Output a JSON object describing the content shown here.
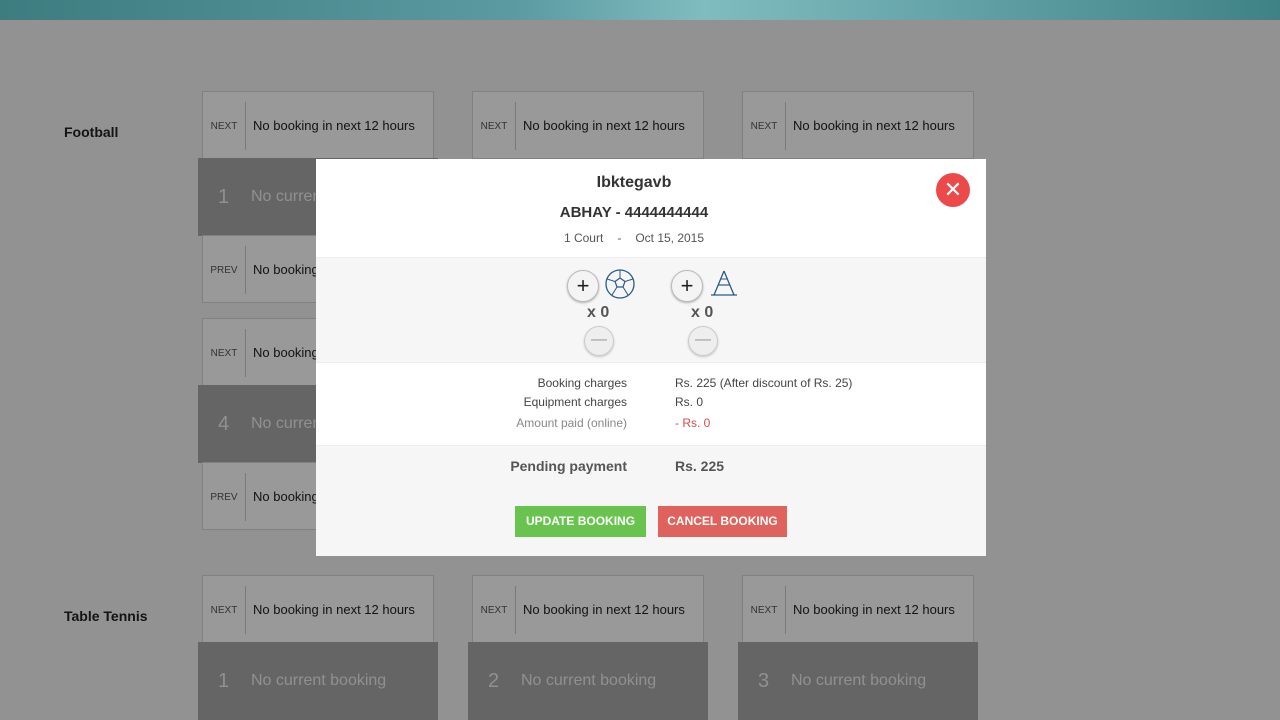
{
  "sections": [
    {
      "name": "Football",
      "cards": [
        {
          "tag": "NEXT",
          "text": "No booking in next 12 hours"
        },
        {
          "tag": "NEXT",
          "text": "No booking in next 12 hours"
        },
        {
          "tag": "NEXT",
          "text": "No booking in next 12 hours"
        },
        {
          "tag": "PREV",
          "text": "No booking"
        },
        {
          "tag": "NEXT",
          "text": "No booking"
        },
        {
          "tag": "PREV",
          "text": "No booking"
        }
      ],
      "courts": [
        {
          "num": "1",
          "text": "No current"
        },
        {
          "num": "4",
          "text": "No curren"
        }
      ]
    },
    {
      "name": "Table Tennis",
      "cards": [
        {
          "tag": "NEXT",
          "text": "No booking in next 12 hours"
        },
        {
          "tag": "NEXT",
          "text": "No booking in next 12 hours"
        },
        {
          "tag": "NEXT",
          "text": "No booking in next 12 hours"
        }
      ],
      "courts": [
        {
          "num": "1",
          "text": "No current booking"
        },
        {
          "num": "2",
          "text": "No current booking"
        },
        {
          "num": "3",
          "text": "No current booking"
        }
      ]
    }
  ],
  "modal": {
    "title": "Ibktegavb",
    "user": "ABHAY - 4444444444",
    "court": "1 Court",
    "separator": "-",
    "date": "Oct 15, 2015",
    "close_icon": "close-icon",
    "equipment": [
      {
        "icon": "football-icon",
        "plus": "+",
        "count": "x 0",
        "minus": "—"
      },
      {
        "icon": "table-tennis-icon",
        "plus": "+",
        "count": "x 0",
        "minus": "—"
      }
    ],
    "charges": {
      "booking_label": "Booking charges",
      "booking_value": "Rs. 225 (After discount of Rs. 25)",
      "equipment_label": "Equipment charges",
      "equipment_value": "Rs. 0",
      "paid_label": "Amount paid (online)",
      "paid_value": "- Rs. 0"
    },
    "pending_label": "Pending payment",
    "pending_value": "Rs. 225",
    "update_label": "UPDATE BOOKING",
    "cancel_label": "CANCEL BOOKING"
  }
}
